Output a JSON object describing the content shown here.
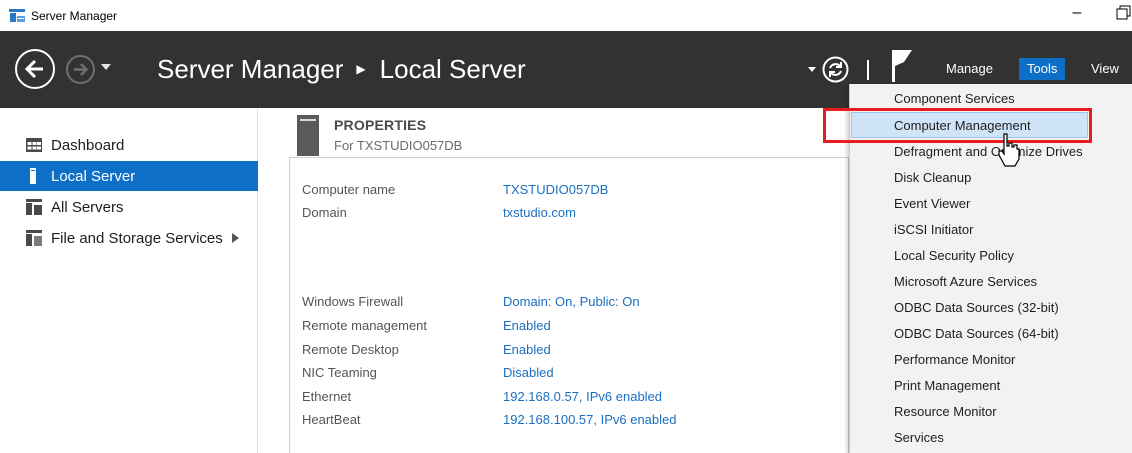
{
  "window": {
    "title": "Server Manager",
    "minimize_glyph": "–"
  },
  "header": {
    "breadcrumb_root": "Server Manager",
    "breadcrumb_separator": "▶",
    "breadcrumb_current": "Local Server",
    "menus": {
      "manage": "Manage",
      "tools": "Tools",
      "view": "View"
    },
    "icons": [
      "back-arrow-icon",
      "forward-arrow-icon",
      "refresh-icon",
      "notification-flag-icon"
    ]
  },
  "sidebar": {
    "items": [
      {
        "label": "Dashboard",
        "icon": "dashboard-icon",
        "active": false
      },
      {
        "label": "Local Server",
        "icon": "local-server-icon",
        "active": true
      },
      {
        "label": "All Servers",
        "icon": "all-servers-icon",
        "active": false
      },
      {
        "label": "File and Storage Services",
        "icon": "file-storage-icon",
        "active": false,
        "has_submenu": true
      }
    ]
  },
  "properties": {
    "title": "PROPERTIES",
    "subtitle": "For TXSTUDIO057DB",
    "rows": [
      {
        "label": "Computer name",
        "value": "TXSTUDIO057DB"
      },
      {
        "label": "Domain",
        "value": "txstudio.com"
      },
      {
        "label": "Windows Firewall",
        "value": "Domain: On, Public: On"
      },
      {
        "label": "Remote management",
        "value": "Enabled"
      },
      {
        "label": "Remote Desktop",
        "value": "Enabled"
      },
      {
        "label": "NIC Teaming",
        "value": "Disabled"
      },
      {
        "label": "Ethernet",
        "value": "192.168.0.57, IPv6 enabled"
      },
      {
        "label": "HeartBeat",
        "value": "192.168.100.57, IPv6 enabled"
      }
    ]
  },
  "tools_menu": {
    "items": [
      "Component Services",
      "Computer Management",
      "Defragment and Optimize Drives",
      "Disk Cleanup",
      "Event Viewer",
      "iSCSI Initiator",
      "Local Security Policy",
      "Microsoft Azure Services",
      "ODBC Data Sources (32-bit)",
      "ODBC Data Sources (64-bit)",
      "Performance Monitor",
      "Print Management",
      "Resource Monitor",
      "Services"
    ],
    "hovered": "Computer Management"
  },
  "colors": {
    "accent": "#0e6fc7",
    "header_bg": "#323232",
    "link": "#1a6fc1",
    "annotation": "#e81c1c"
  }
}
